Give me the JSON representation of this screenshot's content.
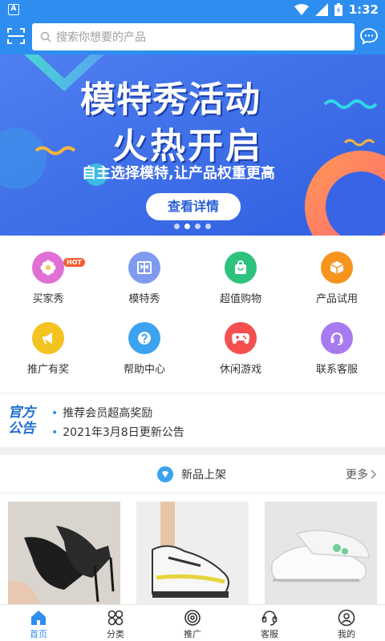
{
  "status_bar": {
    "time": "1:32",
    "notification_letter": "A"
  },
  "search": {
    "placeholder": "搜索你想要的产品"
  },
  "banner": {
    "title_line1": "模特秀活动",
    "title_line2": "火热开启",
    "subtitle": "自主选择模特,让产品权重更高",
    "button_label": "查看详情",
    "slide_count": 4,
    "active_slide": 2
  },
  "grid": {
    "items": [
      {
        "label": "买家秀",
        "icon": "flower-icon",
        "color": "#e070d3",
        "badge": "HOT"
      },
      {
        "label": "模特秀",
        "icon": "book-icon",
        "color": "#7f9bef"
      },
      {
        "label": "超值购物",
        "icon": "shopping-bag-icon",
        "color": "#2ec27e"
      },
      {
        "label": "产品试用",
        "icon": "box-icon",
        "color": "#f7941d"
      },
      {
        "label": "推广有奖",
        "icon": "megaphone-icon",
        "color": "#f3c321"
      },
      {
        "label": "帮助中心",
        "icon": "help-icon",
        "color": "#3ba3f0"
      },
      {
        "label": "休闲游戏",
        "icon": "gamepad-icon",
        "color": "#f45050"
      },
      {
        "label": "联系客服",
        "icon": "headset-icon",
        "color": "#a77bf0"
      }
    ]
  },
  "announcement": {
    "logo_line1": "官方",
    "logo_line2": "公告",
    "items": [
      "推荐会员超高奖励",
      "2021年3月8日更新公告"
    ]
  },
  "new_products": {
    "title": "新品上架",
    "more": "更多"
  },
  "tabbar": {
    "tabs": [
      {
        "label": "首页",
        "icon": "home-icon",
        "active": true
      },
      {
        "label": "分类",
        "icon": "category-icon",
        "active": false
      },
      {
        "label": "推广",
        "icon": "promote-icon",
        "active": false
      },
      {
        "label": "客服",
        "icon": "customer-service-icon",
        "active": false
      },
      {
        "label": "我的",
        "icon": "profile-icon",
        "active": false
      }
    ]
  },
  "colors": {
    "primary": "#2d8ef0",
    "banner_bg": "#3a73e9",
    "hot_badge": "#f35d2f"
  }
}
